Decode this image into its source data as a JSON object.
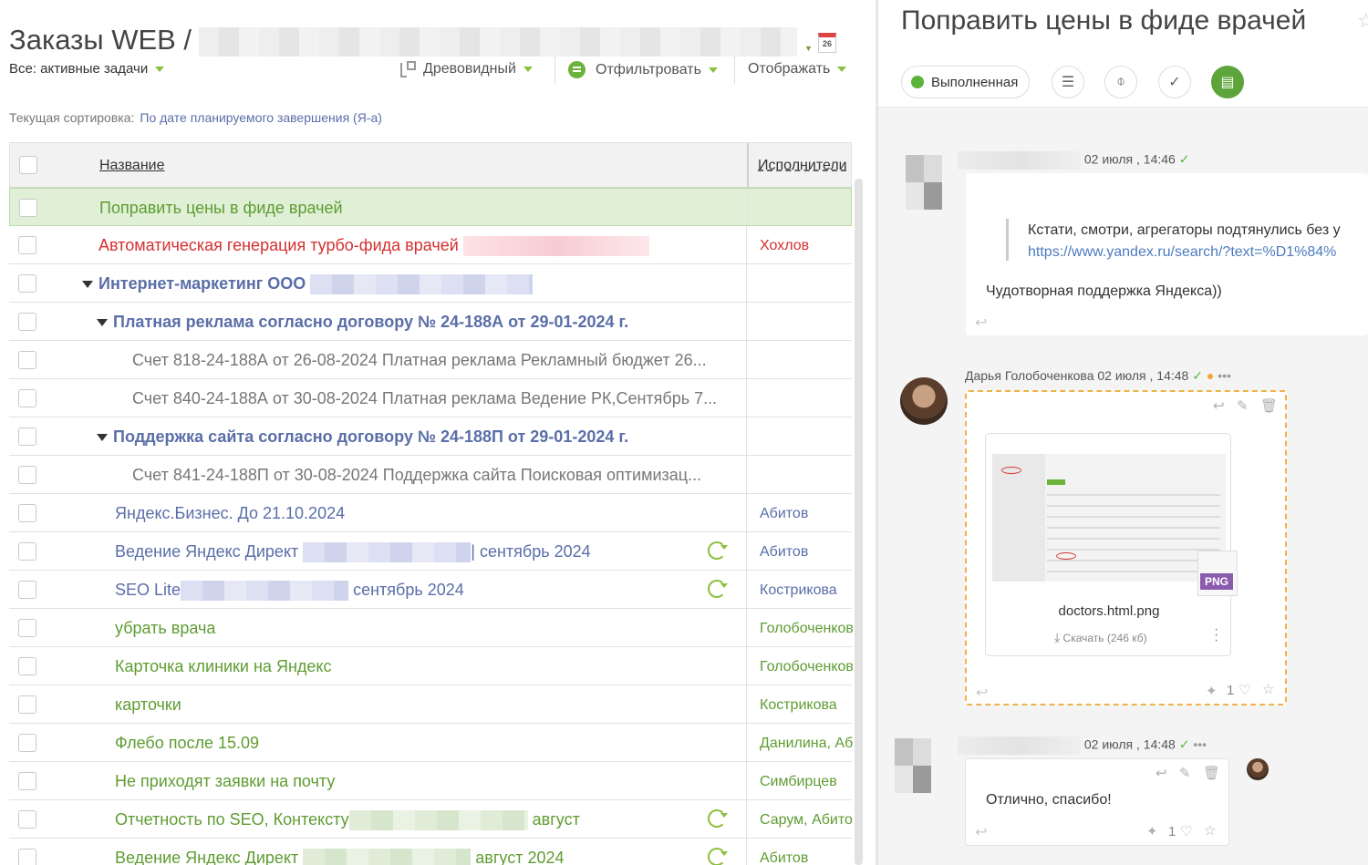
{
  "left": {
    "project_title": "Заказы WEB /",
    "filter_all": "Все: активные задачи",
    "toolbar": {
      "tree_label": "Древовидный",
      "filter_label": "Отфильтровать",
      "display_label": "Отображать"
    },
    "calendar_day": "26",
    "sort": {
      "label": "Текущая сортировка:",
      "value": "По дате планируемого завершения (Я-а)"
    },
    "table": {
      "col_name": "Название",
      "col_assignee": "Исполнители",
      "rows": [
        {
          "name": "Поправить цены в фиде врачей",
          "assignee": ""
        },
        {
          "name": "Автоматическая генерация турбо-фида врачей",
          "assignee": "Хохлов"
        },
        {
          "name": "Интернет-маркетинг ООО",
          "assignee": ""
        },
        {
          "name": "Платная реклама согласно договору № 24-188А от 29-01-2024 г.",
          "assignee": ""
        },
        {
          "name": "Счет 818-24-188А от 26-08-2024 Платная реклама Рекламный бюджет 26...",
          "assignee": ""
        },
        {
          "name": "Счет 840-24-188А от 30-08-2024 Платная реклама Ведение РК,Сентябрь 7...",
          "assignee": ""
        },
        {
          "name": "Поддержка сайта согласно договору № 24-188П от 29-01-2024 г.",
          "assignee": ""
        },
        {
          "name": "Счет 841-24-188П от 30-08-2024 Поддержка сайта Поисковая оптимизац...",
          "assignee": ""
        },
        {
          "name": "Яндекс.Бизнес. До 21.10.2024",
          "assignee": "Абитов"
        },
        {
          "name": "Ведение Яндекс Директ",
          "name_suffix": "| сентябрь 2024",
          "assignee": "Абитов"
        },
        {
          "name": "SEO Lite",
          "name_suffix": "сентябрь 2024",
          "assignee": "Кострикова"
        },
        {
          "name": "убрать врача",
          "assignee": "Голобоченкова"
        },
        {
          "name": "Карточка клиники на Яндекс",
          "assignee": "Голобоченкова"
        },
        {
          "name": "карточки",
          "assignee": "Кострикова"
        },
        {
          "name": "Флебо после 15.09",
          "assignee": "Данилина, Абитов"
        },
        {
          "name": "Не приходят заявки на почту",
          "assignee": "Симбирцев"
        },
        {
          "name": "Отчетность по SEO, Контексту",
          "name_suffix": "август",
          "assignee": "Сарум, Абитов"
        },
        {
          "name": "Ведение Яндекс Директ",
          "name_suffix": "август 2024",
          "assignee": "Абитов"
        }
      ]
    }
  },
  "right": {
    "title": "Поправить цены в фиде врачей",
    "status_label": "Выполненная",
    "messages": [
      {
        "meta": "02 июля , 14:46",
        "quote": "Кстати, смотри, агрегаторы подтянулись без у",
        "link": "https://www.yandex.ru/search/?text=%D1%84%",
        "text": "Чудотворная поддержка Яндекса))"
      },
      {
        "author": "Дарья Голобоченкова",
        "meta": "02 июля , 14:48",
        "file_name": "doctors.html.png",
        "file_type": "PNG",
        "download_label": "Скачать",
        "file_size": "(246 кб)",
        "likes": "1"
      },
      {
        "meta": "02 июля , 14:48",
        "text": "Отлично, спасибо!",
        "likes": "1"
      }
    ]
  }
}
